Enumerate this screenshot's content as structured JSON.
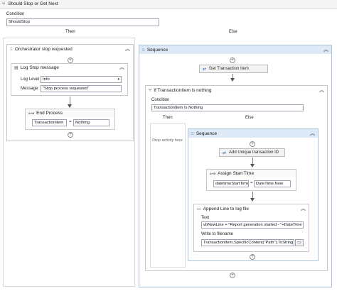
{
  "window": {
    "title": "Should Stop or Get Next"
  },
  "main_if": {
    "condition_label": "Condition",
    "condition_value": "ShouldStop",
    "then_label": "Then",
    "else_label": "Else"
  },
  "orchestrator": {
    "title": "Orchestrator stop requested",
    "log_message": {
      "title": "Log Stop message",
      "log_level_label": "Log Level",
      "log_level_value": "Info",
      "message_label": "Message",
      "message_value": "\"Stop process requested\""
    },
    "end_process": {
      "title": "End Process",
      "left_value": "TransactionItem",
      "operator": "=",
      "right_value": "Nothing"
    }
  },
  "sequence": {
    "title": "Sequence",
    "get_transaction": "Get Transaction Item",
    "inner_if": {
      "title": "If TransactionItem is nothing",
      "condition_label": "Condition",
      "condition_value": "TransactionItem Is Nothing",
      "then_label": "Then",
      "else_label": "Else",
      "drop_activity": "Drop activity here"
    },
    "inner_sequence": {
      "title": "Sequence",
      "add_transaction": "Add Unique transaction ID",
      "assign": {
        "title": "Assign Start Time",
        "left_value": "datetimeStartTime",
        "operator": "=",
        "right_value": "DateTime.Now"
      },
      "append": {
        "title": "Append Line to log file",
        "text_label": "Text",
        "text_value": "vbNewLine + \"Report generation started - \"+DateTime",
        "write_label": "Write to filename",
        "write_value": "TransactionItem.SpecificContent(\"Path\").ToString"
      }
    }
  },
  "icons": {
    "collapse": "double-chevron-up-icon",
    "add": "plus-circle-icon",
    "folder": "folder-icon"
  }
}
